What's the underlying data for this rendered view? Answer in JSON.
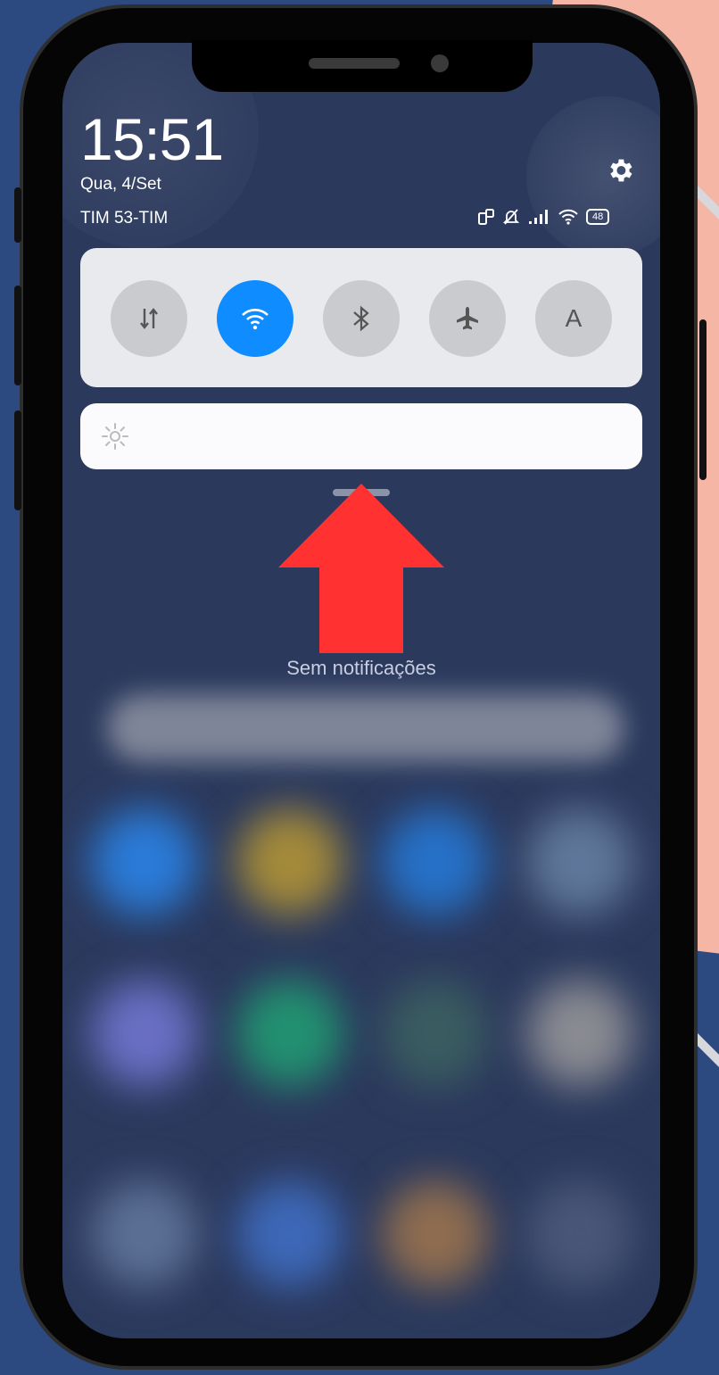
{
  "status_bar": {
    "time": "15:51",
    "date": "Qua, 4/Set",
    "carrier": "TIM 53-TIM",
    "battery_level": "48"
  },
  "quick_settings": {
    "tiles": [
      {
        "name": "mobile-data",
        "glyph": "⇅",
        "active": false
      },
      {
        "name": "wifi",
        "glyph": "wifi-icon",
        "active": true
      },
      {
        "name": "bluetooth",
        "glyph": "∗",
        "active": false
      },
      {
        "name": "airplane-mode",
        "glyph": "✈",
        "active": false
      },
      {
        "name": "auto-brightness",
        "glyph": "A",
        "active": false
      }
    ]
  },
  "notifications": {
    "empty_text": "Sem notificações"
  },
  "annotation": {
    "arrow_color": "#ff3131"
  }
}
